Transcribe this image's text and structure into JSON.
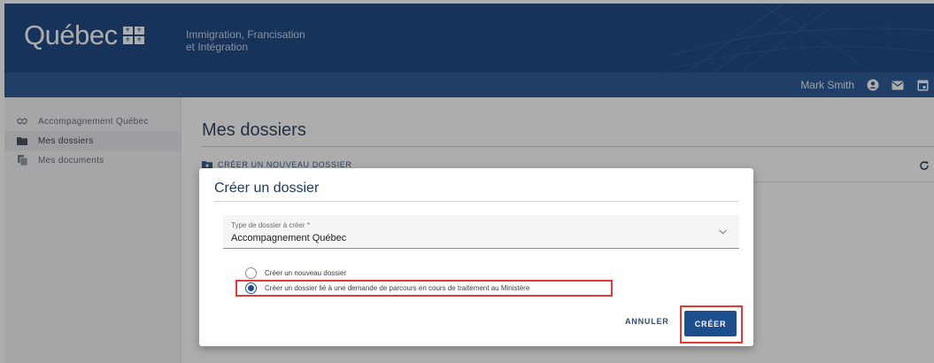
{
  "header": {
    "brand": "Québec",
    "ministry_line1": "Immigration, Francisation",
    "ministry_line2": "et Intégration",
    "brand_color": "#0d3b78"
  },
  "userbar": {
    "user_name": "Mark Smith",
    "icons": [
      "account-icon",
      "mail-icon",
      "calendar-icon"
    ]
  },
  "sidebar": {
    "items": [
      {
        "label": "Accompagnement Québec",
        "icon": "handshake-icon"
      },
      {
        "label": "Mes dossiers",
        "icon": "folder-icon",
        "active": true
      },
      {
        "label": "Mes documents",
        "icon": "documents-icon"
      }
    ]
  },
  "main": {
    "title": "Mes dossiers",
    "new_folder_label": "CRÉER UN NOUVEAU DOSSIER"
  },
  "dialog": {
    "title": "Créer un dossier",
    "select_label": "Type de dossier à créer *",
    "select_value": "Accompagnement Québec",
    "option_new": "Créer un nouveau dossier",
    "option_linked": "Créer un dossier lié à une demande de parcours en cours de traitement au Ministère",
    "selected_option": "linked",
    "cancel_label": "ANNULER",
    "create_label": "CRÉER",
    "accent_color": "#1c4e8d",
    "highlight_color": "#e23a34"
  }
}
